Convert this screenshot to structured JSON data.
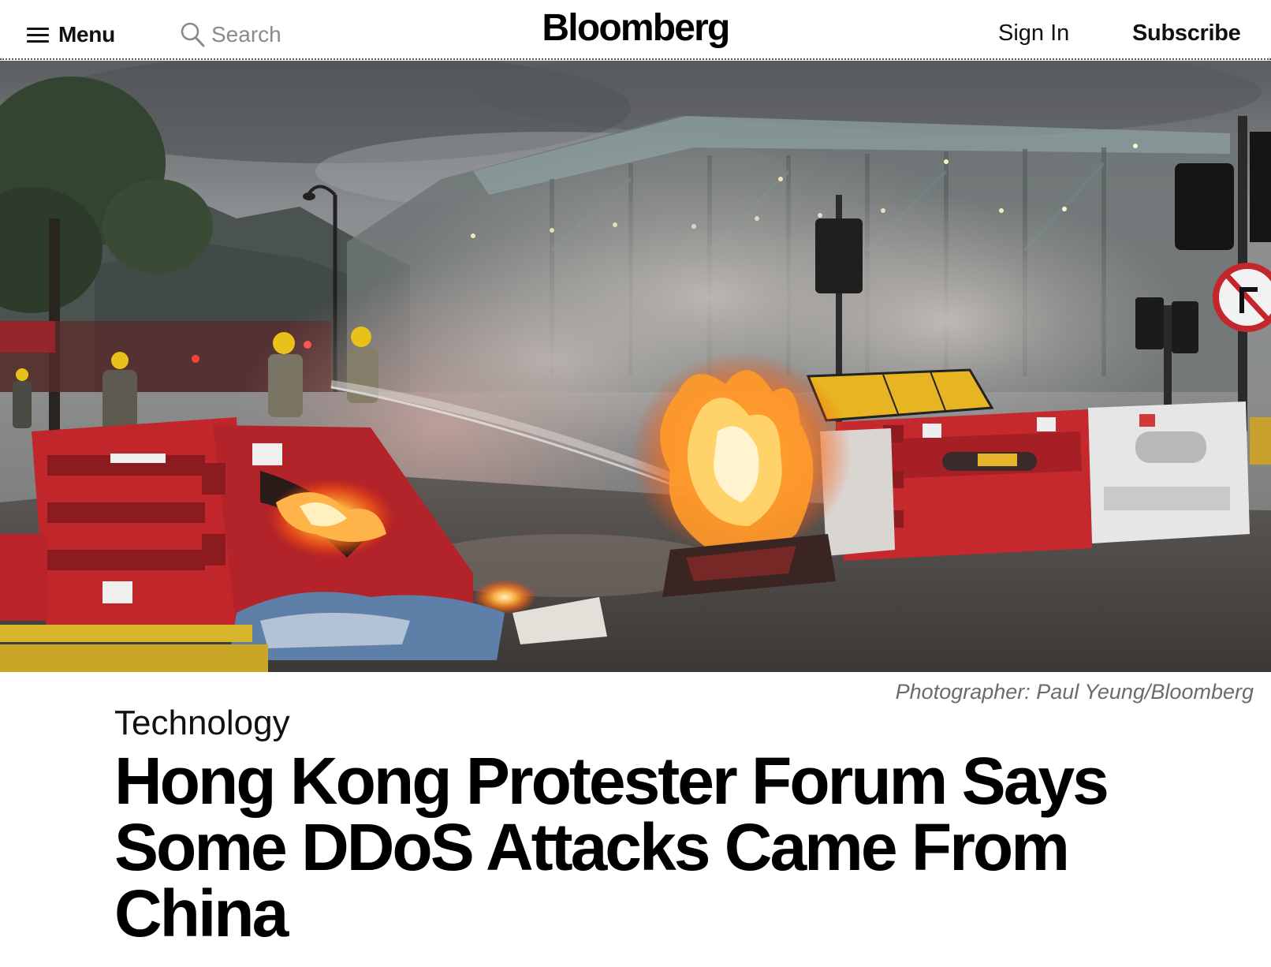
{
  "header": {
    "menu_label": "Menu",
    "search_placeholder": "Search",
    "logo_text": "Bloomberg",
    "sign_in_label": "Sign In",
    "subscribe_label": "Subscribe"
  },
  "hero": {
    "caption": "Photographer: Paul Yeung/Bloomberg"
  },
  "article": {
    "kicker": "Technology",
    "headline": "Hong Kong Protester Forum Says Some DDoS Attacks Came From China"
  }
}
